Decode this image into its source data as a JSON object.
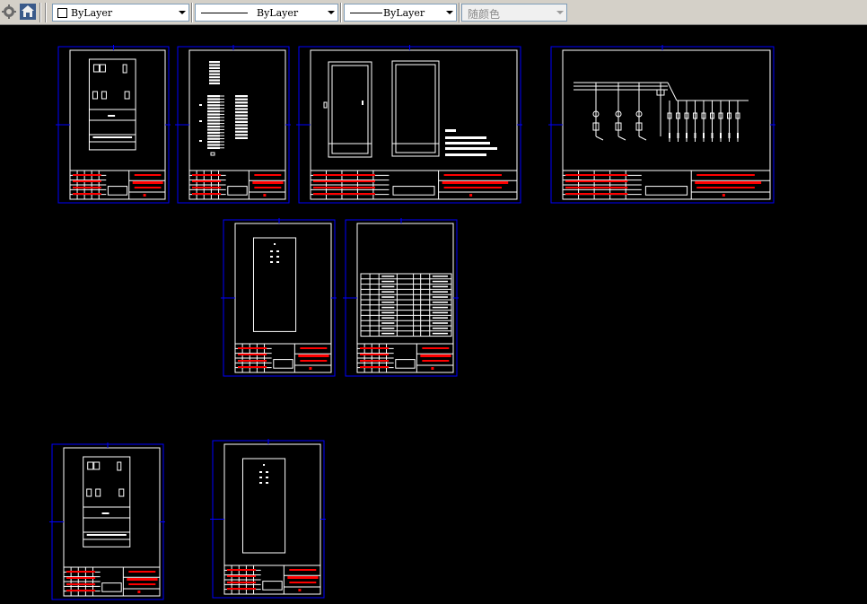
{
  "toolbar": {
    "icons": [
      "layer-settings-icon",
      "home-icon"
    ],
    "layer_combo": {
      "value": "ByLayer"
    },
    "linetype_combo": {
      "value": "ByLayer"
    },
    "lineweight_combo": {
      "value": "ByLayer"
    },
    "color_combo": {
      "value": "随颜色"
    }
  },
  "canvas": {
    "background": "#000000",
    "sheet_border_color": "#0000ff",
    "drawing_line_color": "#ffffff",
    "title_text_color": "#ff0000",
    "sheets": [
      {
        "id": "sheet-1",
        "content": "panel-front"
      },
      {
        "id": "sheet-2",
        "content": "terminal-list"
      },
      {
        "id": "sheet-3",
        "content": "cabinet-views"
      },
      {
        "id": "sheet-4",
        "content": "single-line-schematic"
      },
      {
        "id": "sheet-5",
        "content": "panel-simple"
      },
      {
        "id": "sheet-6",
        "content": "bill-of-materials"
      },
      {
        "id": "sheet-7",
        "content": "panel-front"
      },
      {
        "id": "sheet-8",
        "content": "panel-simple"
      }
    ]
  }
}
